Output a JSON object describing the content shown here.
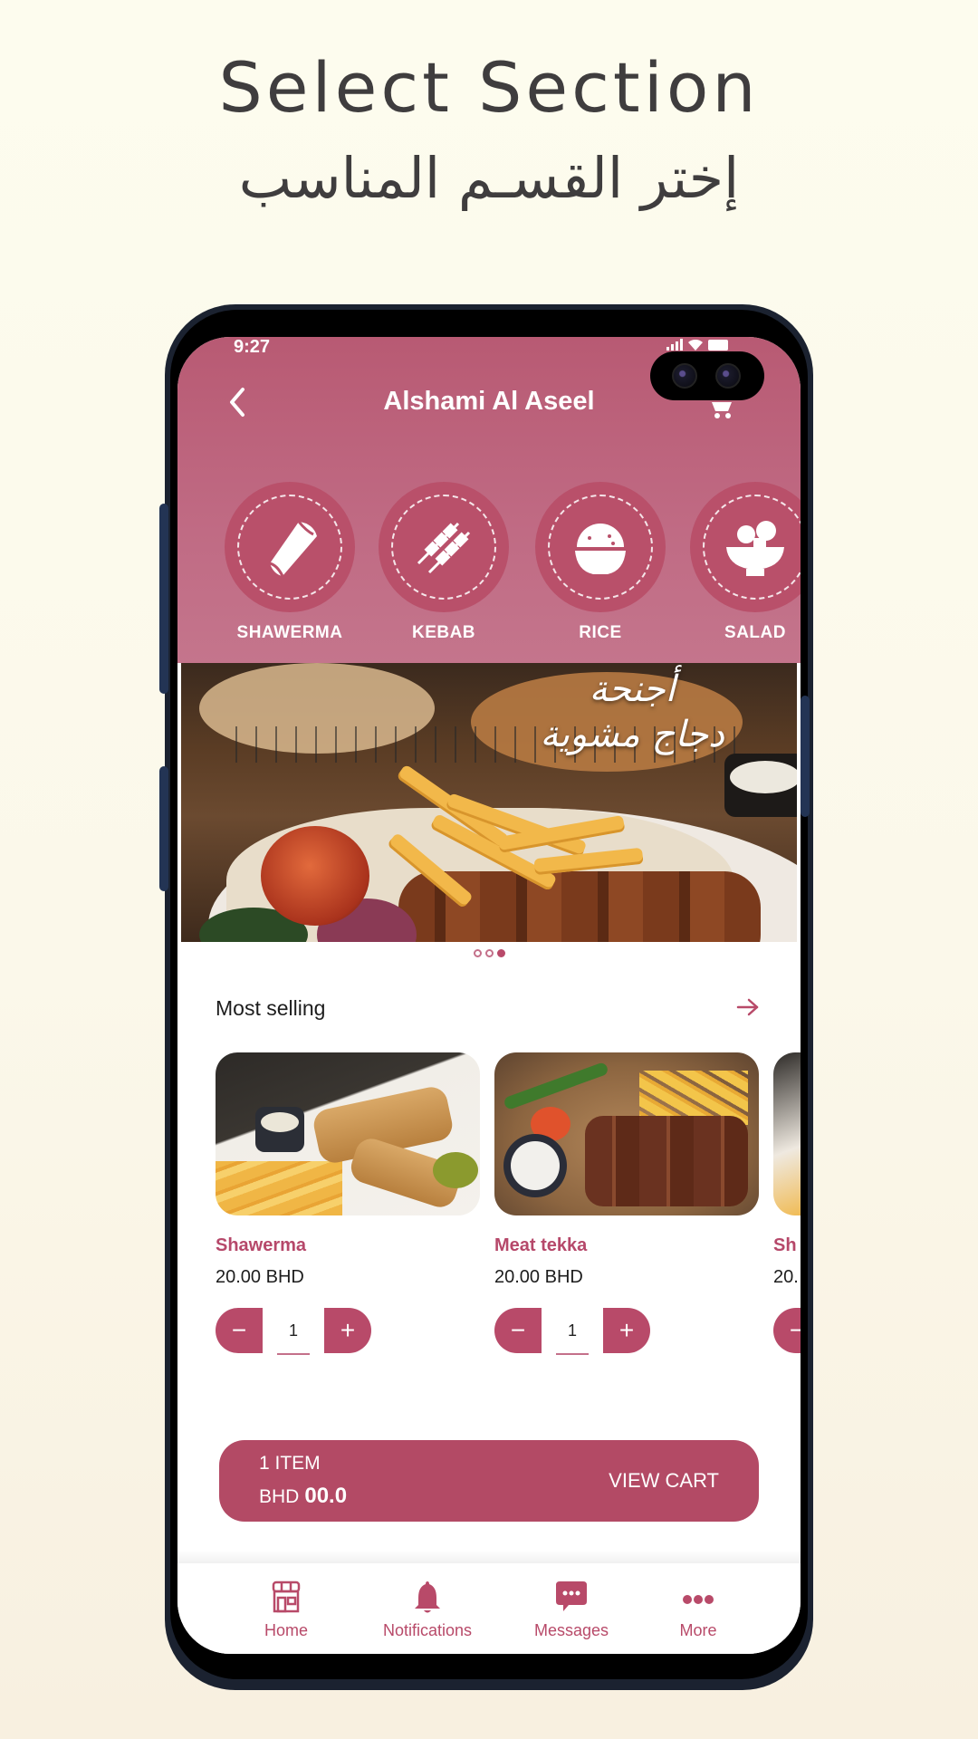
{
  "promo": {
    "title": "Select Section",
    "subtitle": "إختر القسـم المناسب"
  },
  "status_bar": {
    "time": "9:27"
  },
  "header": {
    "title": "Alshami Al Aseel",
    "back_icon": "chevron-left-icon",
    "cart_icon": "cart-icon"
  },
  "categories": [
    {
      "label": "SHAWERMA",
      "icon": "shawerma-wrap-icon"
    },
    {
      "label": "KEBAB",
      "icon": "kebab-skewer-icon"
    },
    {
      "label": "RICE",
      "icon": "rice-bowl-icon"
    },
    {
      "label": "SALAD",
      "icon": "salad-bowl-icon"
    }
  ],
  "banner": {
    "line1": "أجنحة",
    "line2": "دجاج مشوية",
    "slides_total": 3,
    "active_slide": 3
  },
  "most_selling": {
    "title": "Most selling",
    "arrow_icon": "arrow-right-icon",
    "products": [
      {
        "name": "Shawerma",
        "price": "20.00 BHD",
        "quantity": "1"
      },
      {
        "name": "Meat tekka",
        "price": "20.00 BHD",
        "quantity": "1"
      },
      {
        "name": "Sh",
        "price": "20.",
        "quantity": ""
      }
    ],
    "minus_label": "−",
    "plus_label": "+"
  },
  "cart_bar": {
    "count": "1 ITEM",
    "currency": "BHD",
    "total": "00.0",
    "action": "VIEW CART"
  },
  "tabbar": [
    {
      "label": "Home",
      "icon": "store-icon"
    },
    {
      "label": "Notifications",
      "icon": "bell-icon"
    },
    {
      "label": "Messages",
      "icon": "chat-bubble-icon"
    },
    {
      "label": "More",
      "icon": "more-dots-icon"
    }
  ],
  "colors": {
    "brand": "#b84a69",
    "header": "#bc6179",
    "text_dark": "#1d1d1d",
    "promo_text": "#3f3d3e"
  }
}
